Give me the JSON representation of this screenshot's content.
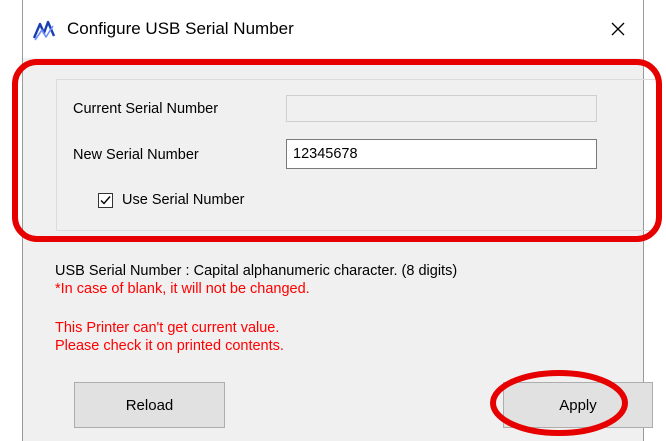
{
  "window": {
    "title": "Configure USB Serial Number",
    "close_glyph": "✕",
    "app_icon": "app-logo-icon"
  },
  "form": {
    "current_serial_label": "Current Serial Number",
    "current_serial_value": "",
    "new_serial_label": "New Serial Number",
    "new_serial_value": "12345678",
    "use_serial_label": "Use Serial Number",
    "use_serial_checked": true
  },
  "info": {
    "format_note": "USB Serial Number : Capital alphanumeric character. (8 digits)",
    "blank_note": "*In case of blank, it will not be changed.",
    "warning_line1": "This Printer can't get current value.",
    "warning_line2": "Please check it on printed contents."
  },
  "buttons": {
    "reload_label": "Reload",
    "apply_label": "Apply"
  },
  "colors": {
    "annotation": "#e60000",
    "warning_text": "#ff0000",
    "window_bg": "#f0f0f0"
  }
}
